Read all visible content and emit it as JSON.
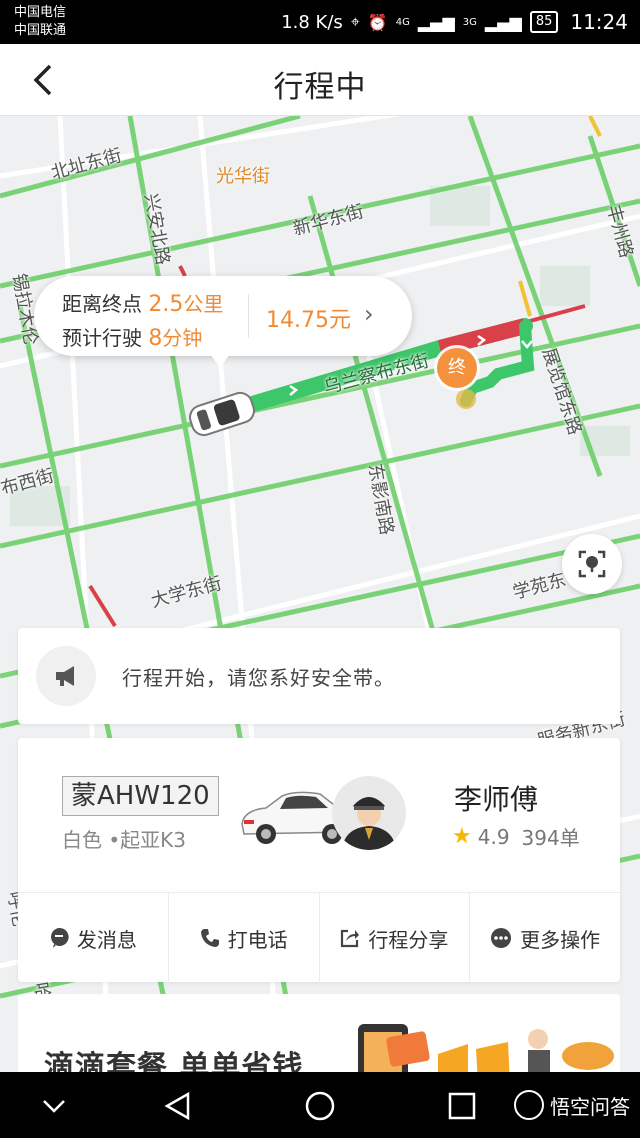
{
  "status_bar": {
    "carrier_1": "中国电信",
    "carrier_2": "中国联通",
    "speed": "1.8 K/s",
    "network_1": "4G",
    "network_2": "3G",
    "battery": "85",
    "time": "11:24"
  },
  "header": {
    "title": "行程中"
  },
  "map": {
    "streets": [
      "北址东街",
      "光华街",
      "兴安北路",
      "新华东街",
      "丰州路",
      "锡拉木伦",
      "乌兰察布东街",
      "展览馆东路",
      "东影南路",
      "大学东街",
      "学苑东",
      "布西街",
      "服务新东街",
      "呼伦",
      "哈"
    ],
    "end_marker": "终"
  },
  "trip_info": {
    "distance_label": "距离终点",
    "distance_value": "2.5",
    "distance_unit": "公里",
    "eta_label": "预计行驶",
    "eta_value": "8",
    "eta_unit": "分钟",
    "fare": "14.75元"
  },
  "notice": {
    "text": "行程开始，请您系好安全带。"
  },
  "driver": {
    "plate": "蒙AHW120",
    "car": "白色 •起亚K3",
    "name": "李师傅",
    "rating": "4.9",
    "orders": "394单"
  },
  "actions": [
    {
      "label": "发消息",
      "icon": "message-icon"
    },
    {
      "label": "打电话",
      "icon": "phone-icon"
    },
    {
      "label": "行程分享",
      "icon": "share-icon"
    },
    {
      "label": "更多操作",
      "icon": "more-icon"
    }
  ],
  "promo": {
    "text": "滴滴套餐 单单省钱"
  },
  "watermark": "悟空问答",
  "colors": {
    "accent": "#f08a34",
    "route_green": "#3ec66a",
    "route_red": "#d9404a",
    "road_green": "#6ecf6a"
  }
}
